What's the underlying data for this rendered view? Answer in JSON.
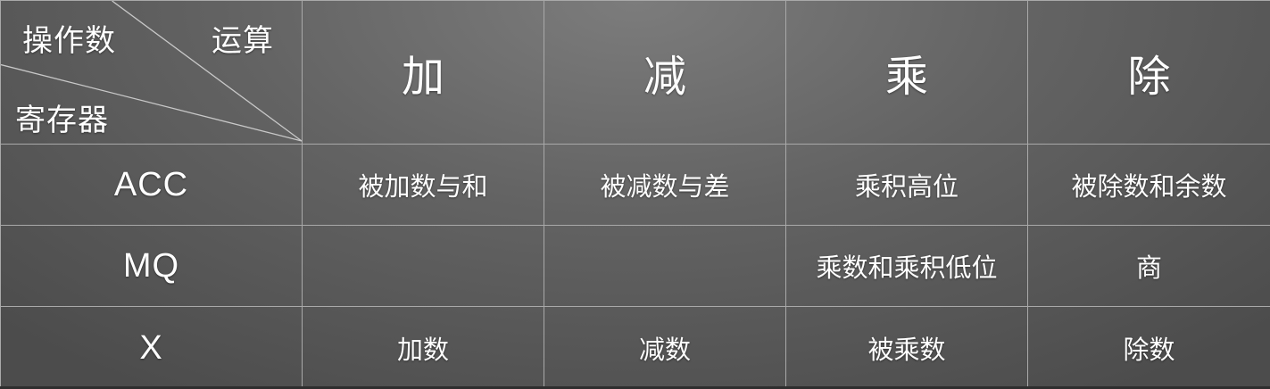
{
  "table": {
    "corner": {
      "operand_label": "操作数",
      "operation_label": "运算",
      "register_label": "寄存器"
    },
    "operations": [
      "加",
      "减",
      "乘",
      "除"
    ],
    "rows": [
      {
        "register": "ACC",
        "cells": [
          "被加数与和",
          "被减数与差",
          "乘积高位",
          "被除数和余数"
        ]
      },
      {
        "register": "MQ",
        "cells": [
          "",
          "",
          "乘数和乘积低位",
          "商"
        ]
      },
      {
        "register": "X",
        "cells": [
          "加数",
          "减数",
          "被乘数",
          "除数"
        ]
      }
    ]
  },
  "colors": {
    "background_center": "#7c7c7c",
    "background_edge": "#4c4c4c",
    "grid_line": "#a9a9a9",
    "text": "#ffffff"
  }
}
